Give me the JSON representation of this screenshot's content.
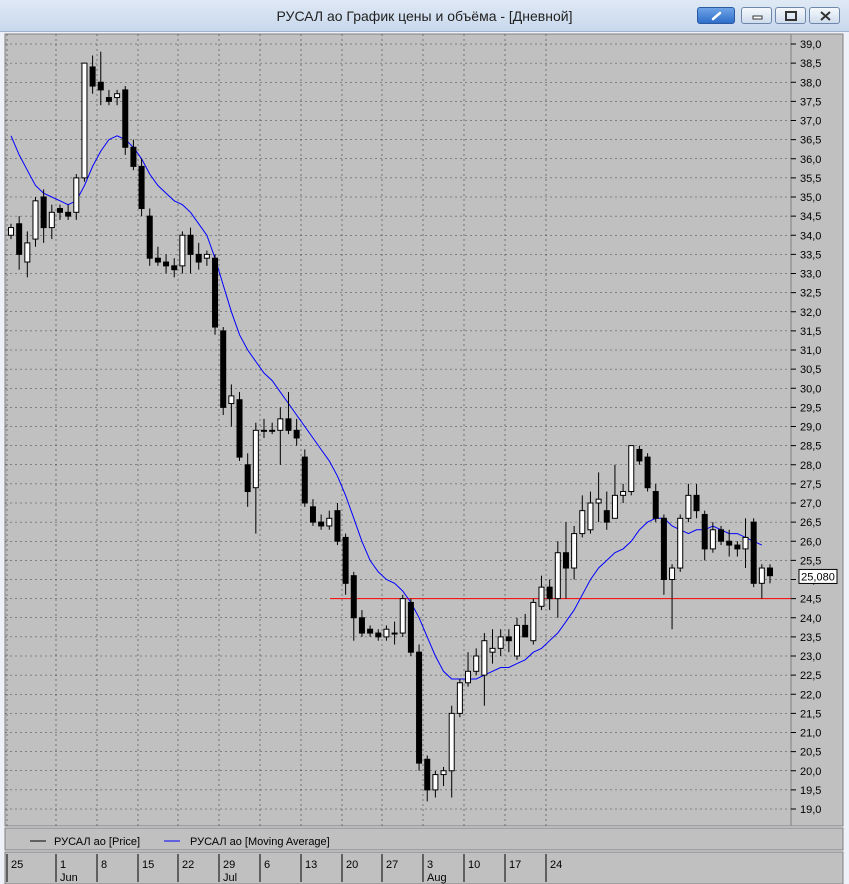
{
  "window": {
    "title": "РУСАЛ ао График цены и объёма - [Дневной]"
  },
  "icons": {
    "link": "link-icon",
    "minimize": "minimize-icon",
    "maximize": "maximize-icon",
    "close": "close-icon"
  },
  "colors": {
    "plot_bg": "#c0c0c0",
    "bull_fill": "#ffffff",
    "bear_fill": "#000000",
    "ma_line": "#0000ff",
    "support_line": "#ff0000",
    "grid": "#404040"
  },
  "chart_data": {
    "type": "candlestick",
    "ylim": [
      19.0,
      39.0
    ],
    "yticks": [
      "39,0",
      "38,5",
      "38,0",
      "37,5",
      "37,0",
      "36,5",
      "36,0",
      "35,5",
      "35,0",
      "34,5",
      "34,0",
      "33,5",
      "33,0",
      "32,5",
      "32,0",
      "31,5",
      "31,0",
      "30,5",
      "30,0",
      "29,5",
      "29,0",
      "28,5",
      "28,0",
      "27,5",
      "27,0",
      "26,5",
      "26,0",
      "25,5",
      "25,0",
      "24,5",
      "24,0",
      "23,5",
      "23,0",
      "22,5",
      "22,0",
      "21,5",
      "21,0",
      "20,5",
      "20,0",
      "19,5",
      "19,0"
    ],
    "last_price_label": "25,080",
    "last_price": 25.08,
    "support_level": 24.5,
    "x_day_labels": [
      "25",
      "1",
      "8",
      "15",
      "22",
      "29",
      "6",
      "13",
      "20",
      "27",
      "3",
      "10",
      "17",
      "24"
    ],
    "x_month_labels": [
      {
        "label": "Jun",
        "after_day": "1"
      },
      {
        "label": "Jul",
        "after_day": "29"
      },
      {
        "label": "Aug",
        "after_day": "3"
      }
    ],
    "legend": [
      {
        "label": "РУСАЛ ао [Price]",
        "color": "#000000"
      },
      {
        "label": "РУСАЛ ао [Moving Average]",
        "color": "#0000ff"
      }
    ],
    "candles": [
      {
        "o": 34.0,
        "h": 34.3,
        "l": 33.9,
        "c": 34.2
      },
      {
        "o": 34.3,
        "h": 34.5,
        "l": 33.1,
        "c": 33.5
      },
      {
        "o": 33.3,
        "h": 34.1,
        "l": 32.9,
        "c": 33.8
      },
      {
        "o": 33.9,
        "h": 35.0,
        "l": 33.7,
        "c": 34.9
      },
      {
        "o": 35.0,
        "h": 35.2,
        "l": 33.8,
        "c": 34.2
      },
      {
        "o": 34.2,
        "h": 34.8,
        "l": 33.9,
        "c": 34.6
      },
      {
        "o": 34.7,
        "h": 34.8,
        "l": 34.4,
        "c": 34.6
      },
      {
        "o": 34.6,
        "h": 34.8,
        "l": 34.4,
        "c": 34.5
      },
      {
        "o": 34.6,
        "h": 35.6,
        "l": 34.4,
        "c": 35.5
      },
      {
        "o": 35.5,
        "h": 38.5,
        "l": 35.4,
        "c": 38.5
      },
      {
        "o": 38.4,
        "h": 38.7,
        "l": 37.7,
        "c": 37.9
      },
      {
        "o": 38.0,
        "h": 38.8,
        "l": 37.4,
        "c": 37.8
      },
      {
        "o": 37.6,
        "h": 37.8,
        "l": 37.4,
        "c": 37.5
      },
      {
        "o": 37.6,
        "h": 37.8,
        "l": 37.4,
        "c": 37.7
      },
      {
        "o": 37.8,
        "h": 37.9,
        "l": 36.1,
        "c": 36.3
      },
      {
        "o": 36.3,
        "h": 36.5,
        "l": 35.7,
        "c": 35.8
      },
      {
        "o": 35.8,
        "h": 36.0,
        "l": 34.5,
        "c": 34.7
      },
      {
        "o": 34.5,
        "h": 34.7,
        "l": 33.2,
        "c": 33.4
      },
      {
        "o": 33.4,
        "h": 33.7,
        "l": 33.2,
        "c": 33.3
      },
      {
        "o": 33.3,
        "h": 33.5,
        "l": 33.0,
        "c": 33.2
      },
      {
        "o": 33.2,
        "h": 33.4,
        "l": 32.9,
        "c": 33.1
      },
      {
        "o": 33.2,
        "h": 34.1,
        "l": 33.0,
        "c": 34.0
      },
      {
        "o": 34.0,
        "h": 34.2,
        "l": 33.0,
        "c": 33.5
      },
      {
        "o": 33.5,
        "h": 33.8,
        "l": 33.1,
        "c": 33.3
      },
      {
        "o": 33.4,
        "h": 33.6,
        "l": 33.2,
        "c": 33.5
      },
      {
        "o": 33.4,
        "h": 33.5,
        "l": 31.4,
        "c": 31.6
      },
      {
        "o": 31.5,
        "h": 31.6,
        "l": 29.3,
        "c": 29.5
      },
      {
        "o": 29.6,
        "h": 30.1,
        "l": 29.0,
        "c": 29.8
      },
      {
        "o": 29.7,
        "h": 29.9,
        "l": 28.1,
        "c": 28.2
      },
      {
        "o": 28.0,
        "h": 28.3,
        "l": 26.9,
        "c": 27.3
      },
      {
        "o": 27.4,
        "h": 29.1,
        "l": 26.2,
        "c": 28.9
      },
      {
        "o": 28.9,
        "h": 29.2,
        "l": 28.7,
        "c": 28.9
      },
      {
        "o": 28.9,
        "h": 29.1,
        "l": 28.8,
        "c": 28.9
      },
      {
        "o": 28.9,
        "h": 29.5,
        "l": 28.0,
        "c": 29.2
      },
      {
        "o": 29.2,
        "h": 29.9,
        "l": 28.8,
        "c": 28.9
      },
      {
        "o": 28.9,
        "h": 29.2,
        "l": 28.5,
        "c": 28.7
      },
      {
        "o": 28.2,
        "h": 28.4,
        "l": 26.9,
        "c": 27.0
      },
      {
        "o": 26.9,
        "h": 27.1,
        "l": 26.4,
        "c": 26.5
      },
      {
        "o": 26.5,
        "h": 26.7,
        "l": 26.3,
        "c": 26.4
      },
      {
        "o": 26.4,
        "h": 26.8,
        "l": 26.3,
        "c": 26.6
      },
      {
        "o": 26.8,
        "h": 27.0,
        "l": 25.9,
        "c": 26.0
      },
      {
        "o": 26.1,
        "h": 26.2,
        "l": 24.6,
        "c": 24.9
      },
      {
        "o": 25.1,
        "h": 25.2,
        "l": 23.4,
        "c": 24.0
      },
      {
        "o": 24.0,
        "h": 24.2,
        "l": 23.5,
        "c": 23.6
      },
      {
        "o": 23.7,
        "h": 23.8,
        "l": 23.5,
        "c": 23.6
      },
      {
        "o": 23.6,
        "h": 23.7,
        "l": 23.4,
        "c": 23.5
      },
      {
        "o": 23.5,
        "h": 23.8,
        "l": 23.4,
        "c": 23.7
      },
      {
        "o": 23.6,
        "h": 23.9,
        "l": 23.3,
        "c": 23.6
      },
      {
        "o": 23.6,
        "h": 24.6,
        "l": 23.5,
        "c": 24.5
      },
      {
        "o": 24.4,
        "h": 24.5,
        "l": 23.0,
        "c": 23.1
      },
      {
        "o": 23.1,
        "h": 23.3,
        "l": 20.0,
        "c": 20.2
      },
      {
        "o": 20.3,
        "h": 20.4,
        "l": 19.2,
        "c": 19.5
      },
      {
        "o": 19.5,
        "h": 20.0,
        "l": 19.3,
        "c": 19.9
      },
      {
        "o": 19.9,
        "h": 20.1,
        "l": 19.6,
        "c": 20.0
      },
      {
        "o": 20.0,
        "h": 21.7,
        "l": 19.3,
        "c": 21.5
      },
      {
        "o": 21.5,
        "h": 22.4,
        "l": 21.4,
        "c": 22.3
      },
      {
        "o": 22.3,
        "h": 23.1,
        "l": 22.2,
        "c": 22.6
      },
      {
        "o": 22.6,
        "h": 23.2,
        "l": 22.5,
        "c": 23.0
      },
      {
        "o": 22.5,
        "h": 23.6,
        "l": 21.7,
        "c": 23.4
      },
      {
        "o": 23.1,
        "h": 23.7,
        "l": 22.8,
        "c": 23.2
      },
      {
        "o": 23.2,
        "h": 23.7,
        "l": 23.0,
        "c": 23.5
      },
      {
        "o": 23.5,
        "h": 23.7,
        "l": 23.1,
        "c": 23.4
      },
      {
        "o": 23.0,
        "h": 24.0,
        "l": 22.9,
        "c": 23.8
      },
      {
        "o": 23.8,
        "h": 24.1,
        "l": 23.5,
        "c": 23.5
      },
      {
        "o": 23.4,
        "h": 24.5,
        "l": 23.3,
        "c": 24.4
      },
      {
        "o": 24.3,
        "h": 25.1,
        "l": 24.2,
        "c": 24.8
      },
      {
        "o": 24.8,
        "h": 25.0,
        "l": 24.2,
        "c": 24.5
      },
      {
        "o": 24.5,
        "h": 26.0,
        "l": 24.0,
        "c": 25.7
      },
      {
        "o": 25.7,
        "h": 26.5,
        "l": 24.5,
        "c": 25.3
      },
      {
        "o": 25.3,
        "h": 26.4,
        "l": 25.0,
        "c": 26.2
      },
      {
        "o": 26.2,
        "h": 27.2,
        "l": 26.1,
        "c": 26.8
      },
      {
        "o": 26.3,
        "h": 27.3,
        "l": 26.2,
        "c": 27.0
      },
      {
        "o": 27.0,
        "h": 27.8,
        "l": 26.5,
        "c": 27.1
      },
      {
        "o": 26.8,
        "h": 27.3,
        "l": 26.3,
        "c": 26.5
      },
      {
        "o": 26.6,
        "h": 28.0,
        "l": 26.6,
        "c": 27.2
      },
      {
        "o": 27.2,
        "h": 27.5,
        "l": 27.0,
        "c": 27.3
      },
      {
        "o": 27.3,
        "h": 28.5,
        "l": 27.2,
        "c": 28.5
      },
      {
        "o": 28.4,
        "h": 28.5,
        "l": 28.0,
        "c": 28.1
      },
      {
        "o": 28.2,
        "h": 28.3,
        "l": 27.3,
        "c": 27.4
      },
      {
        "o": 27.3,
        "h": 27.5,
        "l": 26.5,
        "c": 26.6
      },
      {
        "o": 26.6,
        "h": 26.7,
        "l": 24.6,
        "c": 25.0
      },
      {
        "o": 25.0,
        "h": 25.4,
        "l": 23.7,
        "c": 25.3
      },
      {
        "o": 25.3,
        "h": 26.7,
        "l": 25.2,
        "c": 26.6
      },
      {
        "o": 26.6,
        "h": 27.5,
        "l": 26.5,
        "c": 27.2
      },
      {
        "o": 27.2,
        "h": 27.5,
        "l": 26.6,
        "c": 26.8
      },
      {
        "o": 26.7,
        "h": 26.8,
        "l": 25.5,
        "c": 25.8
      },
      {
        "o": 25.8,
        "h": 26.5,
        "l": 25.7,
        "c": 26.3
      },
      {
        "o": 26.3,
        "h": 26.4,
        "l": 25.9,
        "c": 26.0
      },
      {
        "o": 26.0,
        "h": 26.3,
        "l": 25.6,
        "c": 25.9
      },
      {
        "o": 25.9,
        "h": 26.0,
        "l": 25.6,
        "c": 25.8
      },
      {
        "o": 25.8,
        "h": 26.6,
        "l": 25.3,
        "c": 26.1
      },
      {
        "o": 26.5,
        "h": 26.6,
        "l": 24.8,
        "c": 24.9
      },
      {
        "o": 24.9,
        "h": 25.4,
        "l": 24.5,
        "c": 25.3
      },
      {
        "o": 25.3,
        "h": 25.4,
        "l": 24.9,
        "c": 25.1
      }
    ],
    "moving_average": [
      36.6,
      36.1,
      35.7,
      35.3,
      35.1,
      35.0,
      34.9,
      34.8,
      34.9,
      35.3,
      35.8,
      36.2,
      36.5,
      36.6,
      36.5,
      36.3,
      36.0,
      35.6,
      35.3,
      35.1,
      34.9,
      34.8,
      34.6,
      34.3,
      34.0,
      33.4,
      32.7,
      32.0,
      31.4,
      31.0,
      30.7,
      30.4,
      30.2,
      29.9,
      29.6,
      29.3,
      29.0,
      28.7,
      28.4,
      28.1,
      27.7,
      27.2,
      26.6,
      26.0,
      25.5,
      25.2,
      25.0,
      24.9,
      24.7,
      24.4,
      24.0,
      23.5,
      23.0,
      22.6,
      22.4,
      22.4,
      22.4,
      22.4,
      22.5,
      22.6,
      22.7,
      22.7,
      22.8,
      22.9,
      23.1,
      23.2,
      23.4,
      23.6,
      23.9,
      24.2,
      24.6,
      25.0,
      25.3,
      25.5,
      25.7,
      25.8,
      26.0,
      26.3,
      26.5,
      26.6,
      26.6,
      26.4,
      26.3,
      26.2,
      26.3,
      26.3,
      26.4,
      26.3,
      26.2,
      26.2,
      26.1,
      26.0,
      25.9
    ]
  }
}
